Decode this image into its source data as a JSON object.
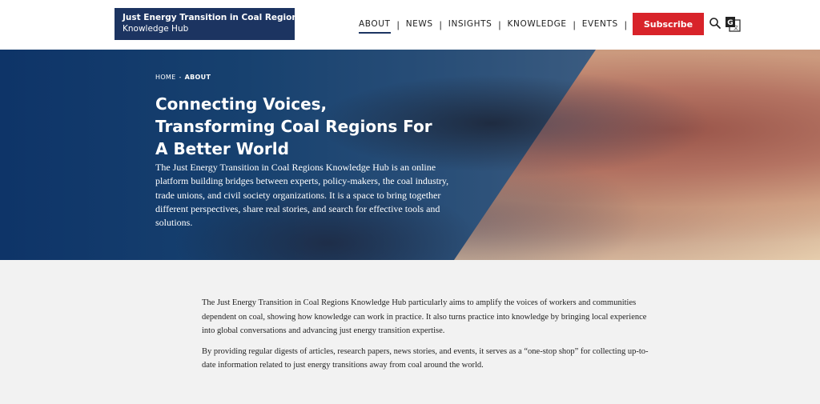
{
  "header": {
    "logo": {
      "line1": "Just Energy Transition in Coal Regions",
      "line2": "Knowledge Hub"
    },
    "nav": [
      "ABOUT",
      "NEWS",
      "INSIGHTS",
      "KNOWLEDGE",
      "EVENTS"
    ],
    "active_nav": "ABOUT",
    "subscribe_label": "Subscribe",
    "icons": {
      "search": "search-icon",
      "translate": "translate-icon"
    }
  },
  "hero": {
    "breadcrumb": {
      "home": "HOME",
      "separator": "-",
      "current": "ABOUT"
    },
    "title": "Connecting Voices, Transforming Coal Regions For A Better World",
    "text": "The Just Energy Transition in Coal Regions Knowledge Hub is an online platform building bridges between experts, policy-makers, the coal industry, trade unions, and civil society organizations. It is a space to bring together different perspectives, share real stories, and search for effective tools and solutions."
  },
  "body": {
    "paragraphs": [
      "The Just Energy Transition in Coal Regions Knowledge Hub particularly aims to amplify the voices of workers and communities dependent on coal, showing how knowledge can work in practice. It also turns practice into knowledge by bringing local experience into global conversations and advancing just energy transition expertise.",
      "By providing regular digests of articles, research papers, news stories, and events, it serves as a “one-stop shop” for collecting up-to-date information related to just energy transitions away from coal around the world."
    ]
  },
  "colors": {
    "brand_navy": "#1c3461",
    "subscribe_red": "#d8232a",
    "body_bg": "#f2f2f2"
  }
}
